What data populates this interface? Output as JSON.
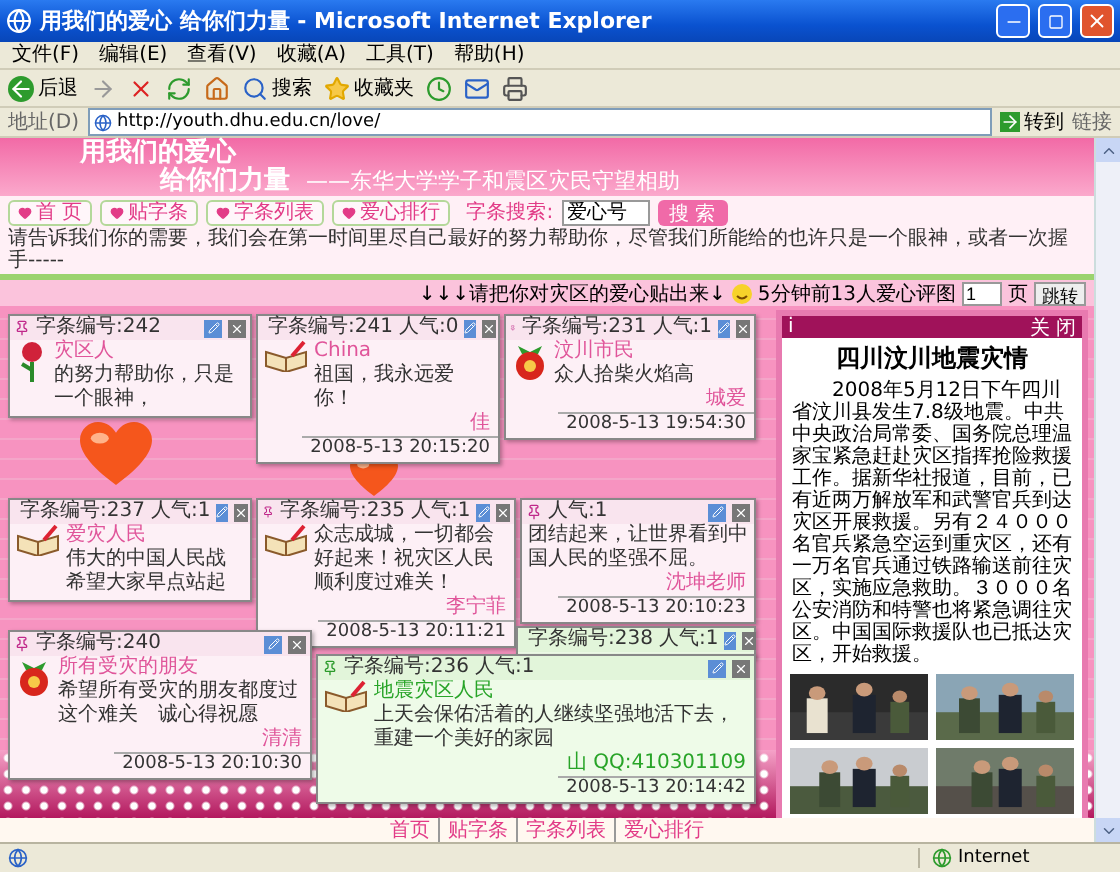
{
  "window": {
    "title": "用我们的爱心 给你们力量 - Microsoft Internet Explorer"
  },
  "menu": [
    "文件(F)",
    "编辑(E)",
    "查看(V)",
    "收藏(A)",
    "工具(T)",
    "帮助(H)"
  ],
  "toolbar": {
    "back": "后退",
    "search": "搜索",
    "favorites": "收藏夹"
  },
  "address": {
    "label": "地址(D)",
    "url": "http://youth.dhu.edu.cn/love/",
    "go": "转到",
    "links": "链接"
  },
  "banner": {
    "line1": "用我们的爱心",
    "line2": "给你们力量",
    "subtitle": "——东华大学学子和震区灾民守望相助"
  },
  "nav": [
    "首 页",
    "贴字条",
    "字条列表",
    "爱心排行"
  ],
  "search": {
    "label": "字条搜索:",
    "value": "爱心号",
    "button": "搜 索"
  },
  "marquee": "请告诉我们你的需要，我们会在第一时间里尽自己最好的努力帮助你，尽管我们所能给的也许只是一个眼神，或者一次握手-----",
  "subbar": {
    "hint": "↓↓↓请把你对灾区的爱心贴出来↓",
    "count": "5分钟前13人爱心评图",
    "page": "1",
    "page_unit": "页",
    "jump": "跳转"
  },
  "notes": [
    {
      "kind": "pink",
      "number": "字条编号:242",
      "avatar": {
        "kind": "flower"
      },
      "name": "灾区人",
      "body": "的努力帮助你，只是一个眼神，"
    },
    {
      "kind": "pink",
      "number": "字条编号:241",
      "hits": "人气:0",
      "avatar": {
        "kind": "book"
      },
      "name": "China",
      "body": "祖国，我永远爱你！",
      "signature": "佳",
      "date": "2008-5-13 20:15:20"
    },
    {
      "kind": "pink",
      "number": "字条编号:231",
      "hits": "人气:1",
      "avatar": {
        "kind": "bag"
      },
      "name": "汶川市民",
      "body": "众人拾柴火焰高",
      "signature": "城爱",
      "date": "2008-5-13 19:54:30"
    },
    {
      "kind": "pink",
      "number": "字条编号:237",
      "hits": "人气:1",
      "avatar": {
        "kind": "book"
      },
      "name": "爱灾人民",
      "body": "伟大的中国人民战希望大家早点站起"
    },
    {
      "kind": "pink",
      "number": "字条编号:235",
      "hits": "人气:1",
      "avatar": {
        "kind": "book"
      },
      "body": "众志成城，一切都会好起来！祝灾区人民顺利度过难关！",
      "signature": "李宁菲",
      "date": "2008-5-13 20:11:21"
    },
    {
      "kind": "pink",
      "hits": "人气:1",
      "body": "团结起来，让世界看到中国人民的坚强不屈。",
      "signature": "沈坤老师",
      "date": "2008-5-13 20:10:23"
    },
    {
      "kind": "pink",
      "number": "字条编号:240",
      "avatar": {
        "kind": "bag"
      },
      "name": "所有受灾的朋友",
      "body": "希望所有受灾的朋友都度过这个难关　诚心得祝愿",
      "signature": "清清",
      "date": "2008-5-13 20:10:30"
    },
    {
      "kind": "green",
      "number": "字条编号:238",
      "hits": "人气:1"
    },
    {
      "kind": "green",
      "number": "字条编号:236",
      "hits": "人气:1",
      "avatar": {
        "kind": "book"
      },
      "name": "地震灾区人民",
      "body": "上天会保佑活着的人继续坚强地活下去，重建一个美好的家园",
      "signature": "山 QQ:410301109",
      "date": "2008-5-13 20:14:42"
    }
  ],
  "panel": {
    "icon": "i",
    "close": "关 闭",
    "title": "四川汶川地震灾情",
    "text": "2008年5月12日下午四川省汶川县发生7.8级地震。中共中央政治局常委、国务院总理温家宝紧急赶赴灾区指挥抢险救援工作。据新华社报道，目前，已有近两万解放军和武警官兵到达灾区开展救援。另有２４０００名官兵紧急空运到重灾区，还有一万名官兵通过铁路输送前往灾区，实施应急救助。３０００名公安消防和特警也将紧急调往灾区。中国国际救援队也已抵达灾区，开始救援。"
  },
  "footer": [
    "首页",
    "贴字条",
    "字条列表",
    "爱心排行"
  ],
  "status": {
    "zone": "Internet"
  }
}
